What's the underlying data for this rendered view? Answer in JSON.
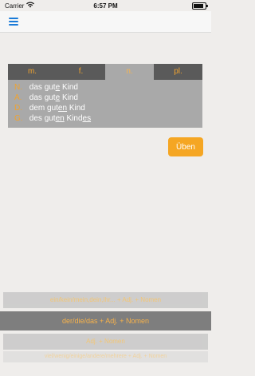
{
  "status_bar": {
    "carrier": "Carrier",
    "time": "6:57 PM"
  },
  "nav": {
    "menu_icon": "hamburger-menu-icon",
    "accent": "#1a7bd8"
  },
  "tabs": [
    {
      "label": "m.",
      "active": false
    },
    {
      "label": "f.",
      "active": false
    },
    {
      "label": "n.",
      "active": true
    },
    {
      "label": "pl.",
      "active": false
    }
  ],
  "declension": [
    {
      "case": "N.",
      "article": "das",
      "adj_stem": "gut",
      "adj_ending": "e",
      "noun_stem": "Kind",
      "noun_ending": ""
    },
    {
      "case": "A.",
      "article": "das",
      "adj_stem": "gut",
      "adj_ending": "e",
      "noun_stem": "Kind",
      "noun_ending": ""
    },
    {
      "case": "D.",
      "article": "dem",
      "adj_stem": "gut",
      "adj_ending": "en",
      "noun_stem": "Kind",
      "noun_ending": ""
    },
    {
      "case": "G.",
      "article": "des",
      "adj_stem": "gut",
      "adj_ending": "en",
      "noun_stem": "Kind",
      "noun_ending": "es"
    }
  ],
  "ueben_button": {
    "label": "Üben",
    "color": "#f5a623"
  },
  "picker": {
    "previous": "ein/kein/mein,dein,ihr... + Adj. + Nomen",
    "selected": "der/die/das + Adj. + Nomen",
    "next": "Adj. + Nomen",
    "next2": "viel/wenig/einige/andere/mehrere + Adj. + Nomen"
  }
}
